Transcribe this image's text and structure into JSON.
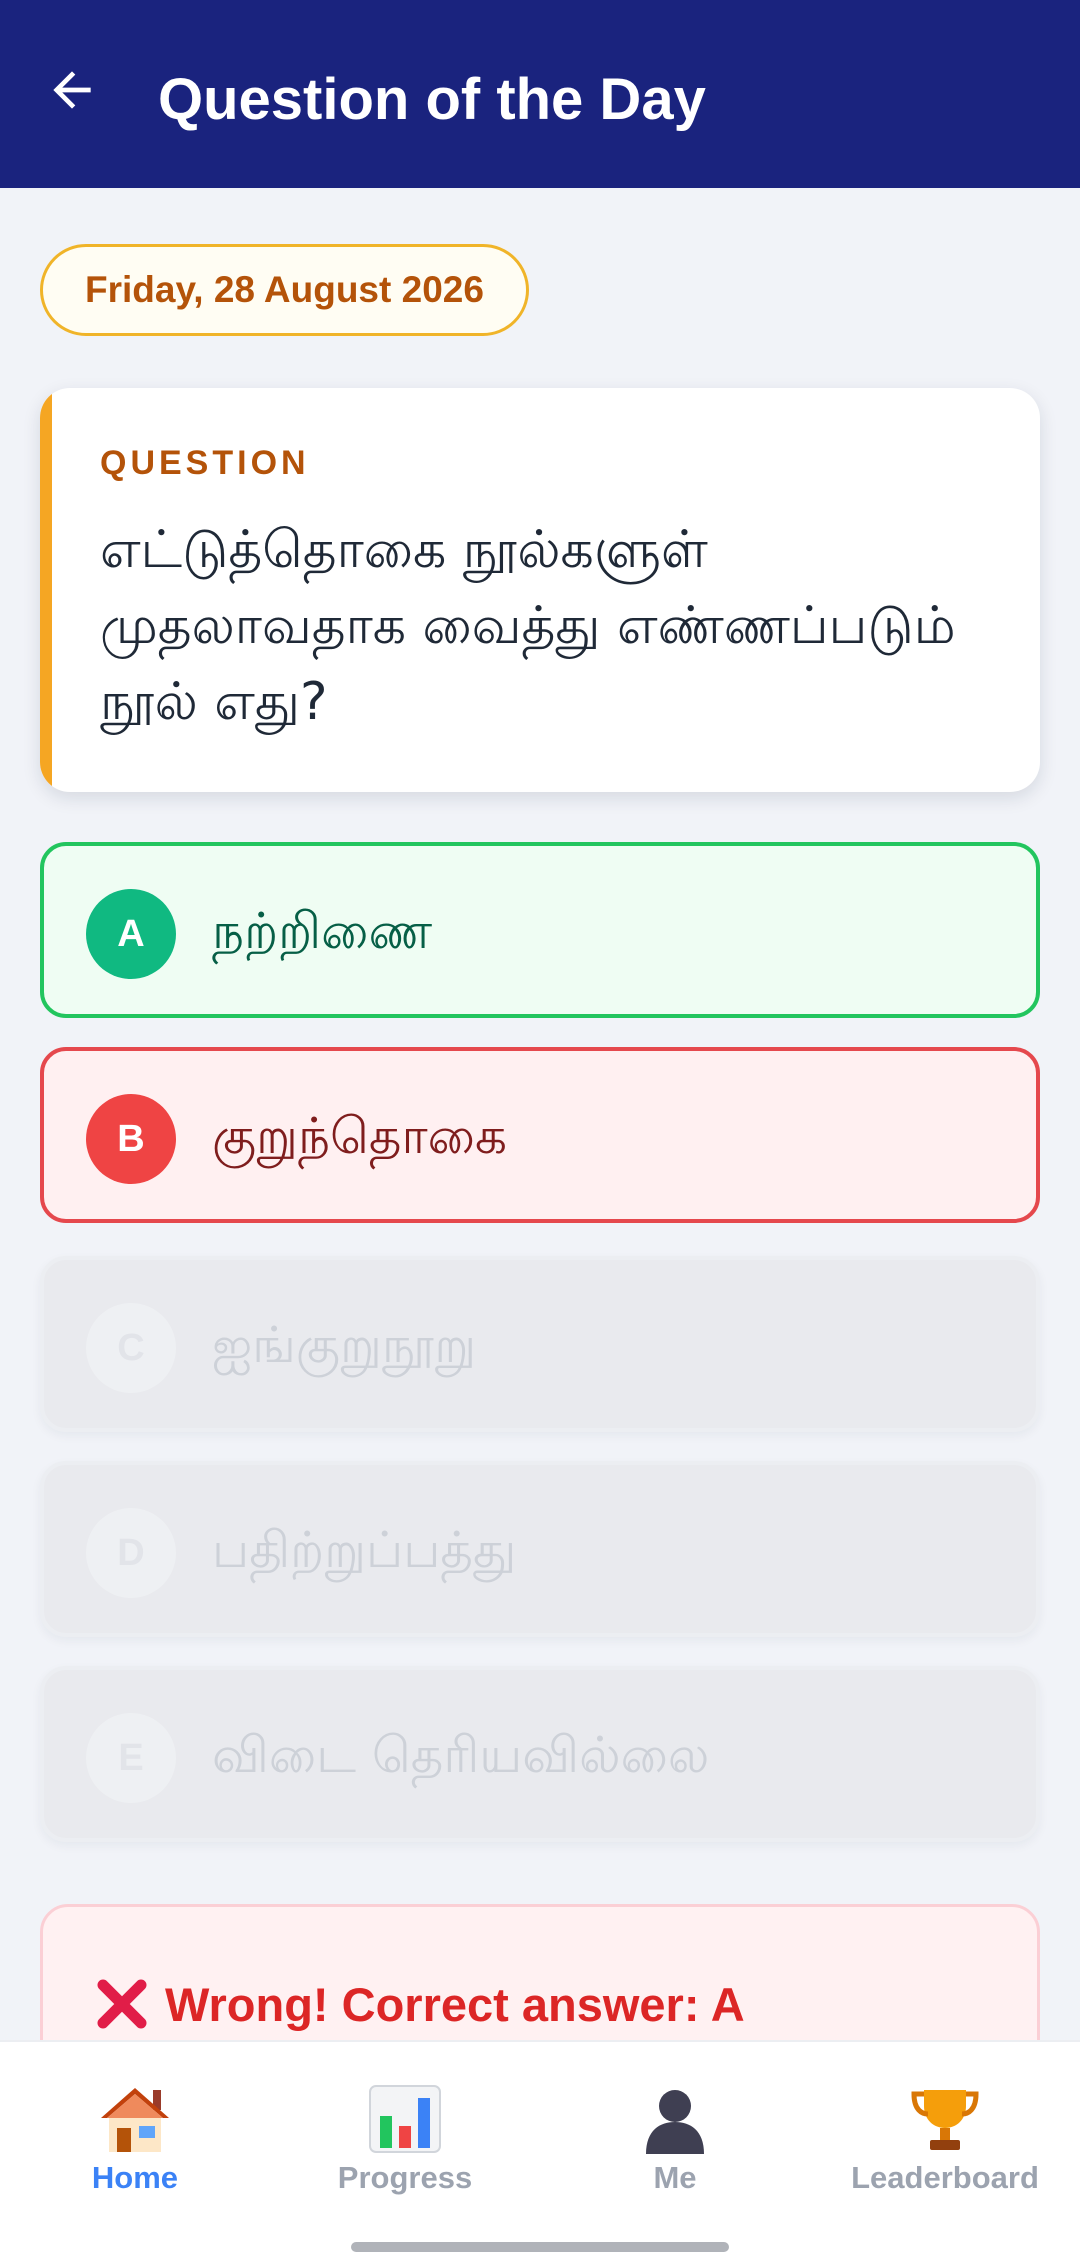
{
  "appbar": {
    "title": "Question of the Day",
    "back_icon": "arrow-left-icon"
  },
  "date": "Friday, 28 August 2026",
  "question": {
    "label": "QUESTION",
    "text": "எட்டுத்தொகை நூல்களுள் முதலாவதாக வைத்து எண்ணப்படும் நூல் எது?"
  },
  "options": [
    {
      "letter": "A",
      "text": "நற்றிணை",
      "state": "correct"
    },
    {
      "letter": "B",
      "text": "குறுந்தொகை",
      "state": "wrong"
    },
    {
      "letter": "C",
      "text": "ஐங்குறுநூறு",
      "state": "disabled"
    },
    {
      "letter": "D",
      "text": "பதிற்றுப்பத்து",
      "state": "disabled"
    },
    {
      "letter": "E",
      "text": "விடை தெரியவில்லை",
      "state": "disabled"
    }
  ],
  "result": {
    "icon": "cross-mark-icon",
    "text": "Wrong! Correct answer: A"
  },
  "nav": {
    "items": [
      {
        "label": "Home",
        "icon": "house-icon",
        "active": true
      },
      {
        "label": "Progress",
        "icon": "bar-chart-icon",
        "active": false
      },
      {
        "label": "Me",
        "icon": "person-silhouette-icon",
        "active": false
      },
      {
        "label": "Leaderboard",
        "icon": "trophy-icon",
        "active": false
      }
    ]
  },
  "colors": {
    "appbar": "#1a237e",
    "accent": "#f5a623",
    "correct": "#22c55e",
    "wrong": "#e5484d",
    "nav_active": "#3b82f6"
  }
}
